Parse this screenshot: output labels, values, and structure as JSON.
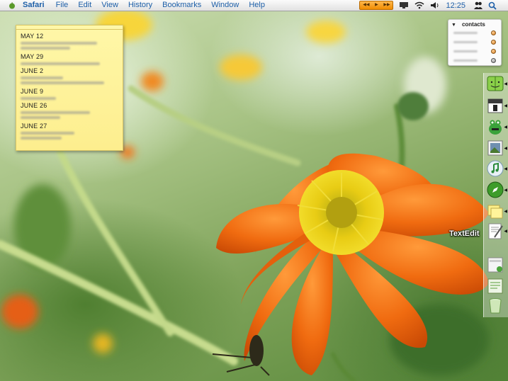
{
  "menubar": {
    "apple_icon": "apple-icon",
    "app_name": "Safari",
    "items": [
      "File",
      "Edit",
      "View",
      "History",
      "Bookmarks",
      "Window",
      "Help"
    ],
    "clock": "12:25",
    "tray_icons": [
      "media-controls-icon",
      "display-icon",
      "wifi-icon",
      "volume-icon",
      "user-icon",
      "spotlight-icon"
    ],
    "accent": "#1d5fa8"
  },
  "sticky_note": {
    "entries": [
      {
        "date": "MAY 12"
      },
      {
        "date": "MAY 29"
      },
      {
        "date": "JUNE 2"
      },
      {
        "date": "JUNE 9"
      },
      {
        "date": "JUNE 26"
      },
      {
        "date": "JUNE 27"
      }
    ],
    "color": "#fdf18f"
  },
  "contacts_widget": {
    "title": "contacts",
    "row_count": 4
  },
  "dock": {
    "icons": [
      "finder-icon",
      "ical-icon",
      "adium-icon",
      "iphoto-icon",
      "itunes-icon",
      "safari-icon",
      "stickies-icon",
      "textedit-icon",
      "preview-icon",
      "script-editor-icon",
      "trash-icon"
    ],
    "hover_label": "TextEdit"
  },
  "wallpaper": {
    "subject": "orange-flower",
    "petal_color": "#ef6a13",
    "center_color": "#e9c80c"
  }
}
